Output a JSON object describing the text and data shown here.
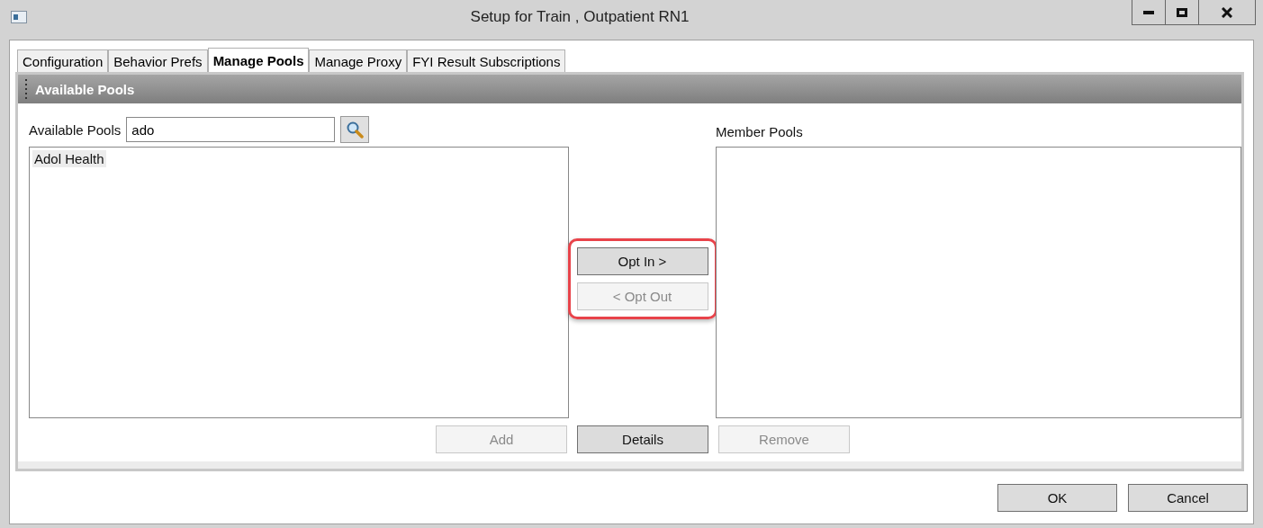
{
  "window": {
    "title": "Setup for Train , Outpatient RN1"
  },
  "tabs": [
    {
      "label": "Configuration",
      "selected": false
    },
    {
      "label": "Behavior Prefs",
      "selected": false
    },
    {
      "label": "Manage Pools",
      "selected": true
    },
    {
      "label": "Manage Proxy",
      "selected": false
    },
    {
      "label": "FYI Result Subscriptions",
      "selected": false
    }
  ],
  "section": {
    "title": "Available Pools"
  },
  "available": {
    "label": "Available Pools",
    "search_value": "ado",
    "items": [
      {
        "label": "Adol Health",
        "selected": true
      }
    ]
  },
  "member": {
    "label": "Member Pools"
  },
  "transfer_buttons": [
    {
      "label": "Opt In >",
      "disabled": false
    },
    {
      "label": "< Opt Out",
      "disabled": true
    }
  ],
  "action_buttons": [
    {
      "label": "Add",
      "disabled": true
    },
    {
      "label": "Details",
      "disabled": false
    },
    {
      "label": "Remove",
      "disabled": true
    }
  ],
  "dialog_buttons": [
    {
      "label": "OK",
      "disabled": false
    },
    {
      "label": "Cancel",
      "disabled": false
    }
  ]
}
